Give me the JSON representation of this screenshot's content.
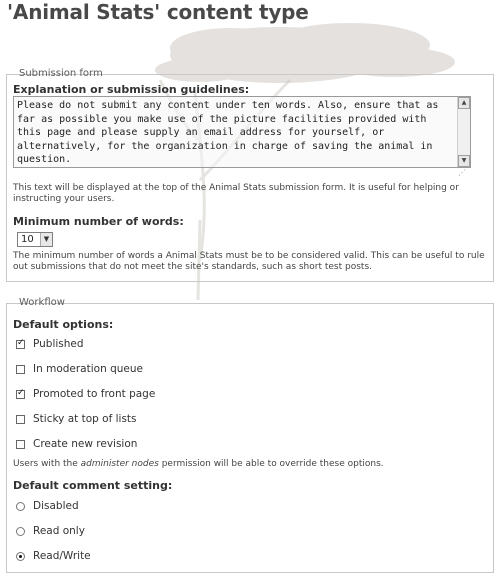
{
  "page": {
    "title": "'Animal Stats' content type"
  },
  "submission_form": {
    "legend": "Submission form",
    "guidelines_label": "Explanation or submission guidelines:",
    "guidelines_value": "Please do not submit any content under ten words. Also, ensure that as far as possible you make use of the picture facilities provided with this page and please supply an email address for yourself, or alternatively, for the organization in charge of saving the animal in question.",
    "guidelines_help": "This text will be displayed at the top of the Animal Stats submission form. It is useful for helping or instructing your users.",
    "min_words_label": "Minimum number of words:",
    "min_words_value": "10",
    "min_words_help": "The minimum number of words a Animal Stats must be to be considered valid. This can be useful to rule out submissions that do not meet the site's standards, such as short test posts."
  },
  "workflow": {
    "legend": "Workflow",
    "default_options_label": "Default options:",
    "options": [
      {
        "label": "Published",
        "checked": true
      },
      {
        "label": "In moderation queue",
        "checked": false
      },
      {
        "label": "Promoted to front page",
        "checked": true
      },
      {
        "label": "Sticky at top of lists",
        "checked": false
      },
      {
        "label": "Create new revision",
        "checked": false
      }
    ],
    "override_note_pre": "Users with the ",
    "override_note_em": "administer nodes",
    "override_note_post": " permission will be able to override these options.",
    "comment_setting_label": "Default comment setting:",
    "comment_options": [
      {
        "label": "Disabled",
        "selected": false
      },
      {
        "label": "Read only",
        "selected": false
      },
      {
        "label": "Read/Write",
        "selected": true
      }
    ]
  }
}
